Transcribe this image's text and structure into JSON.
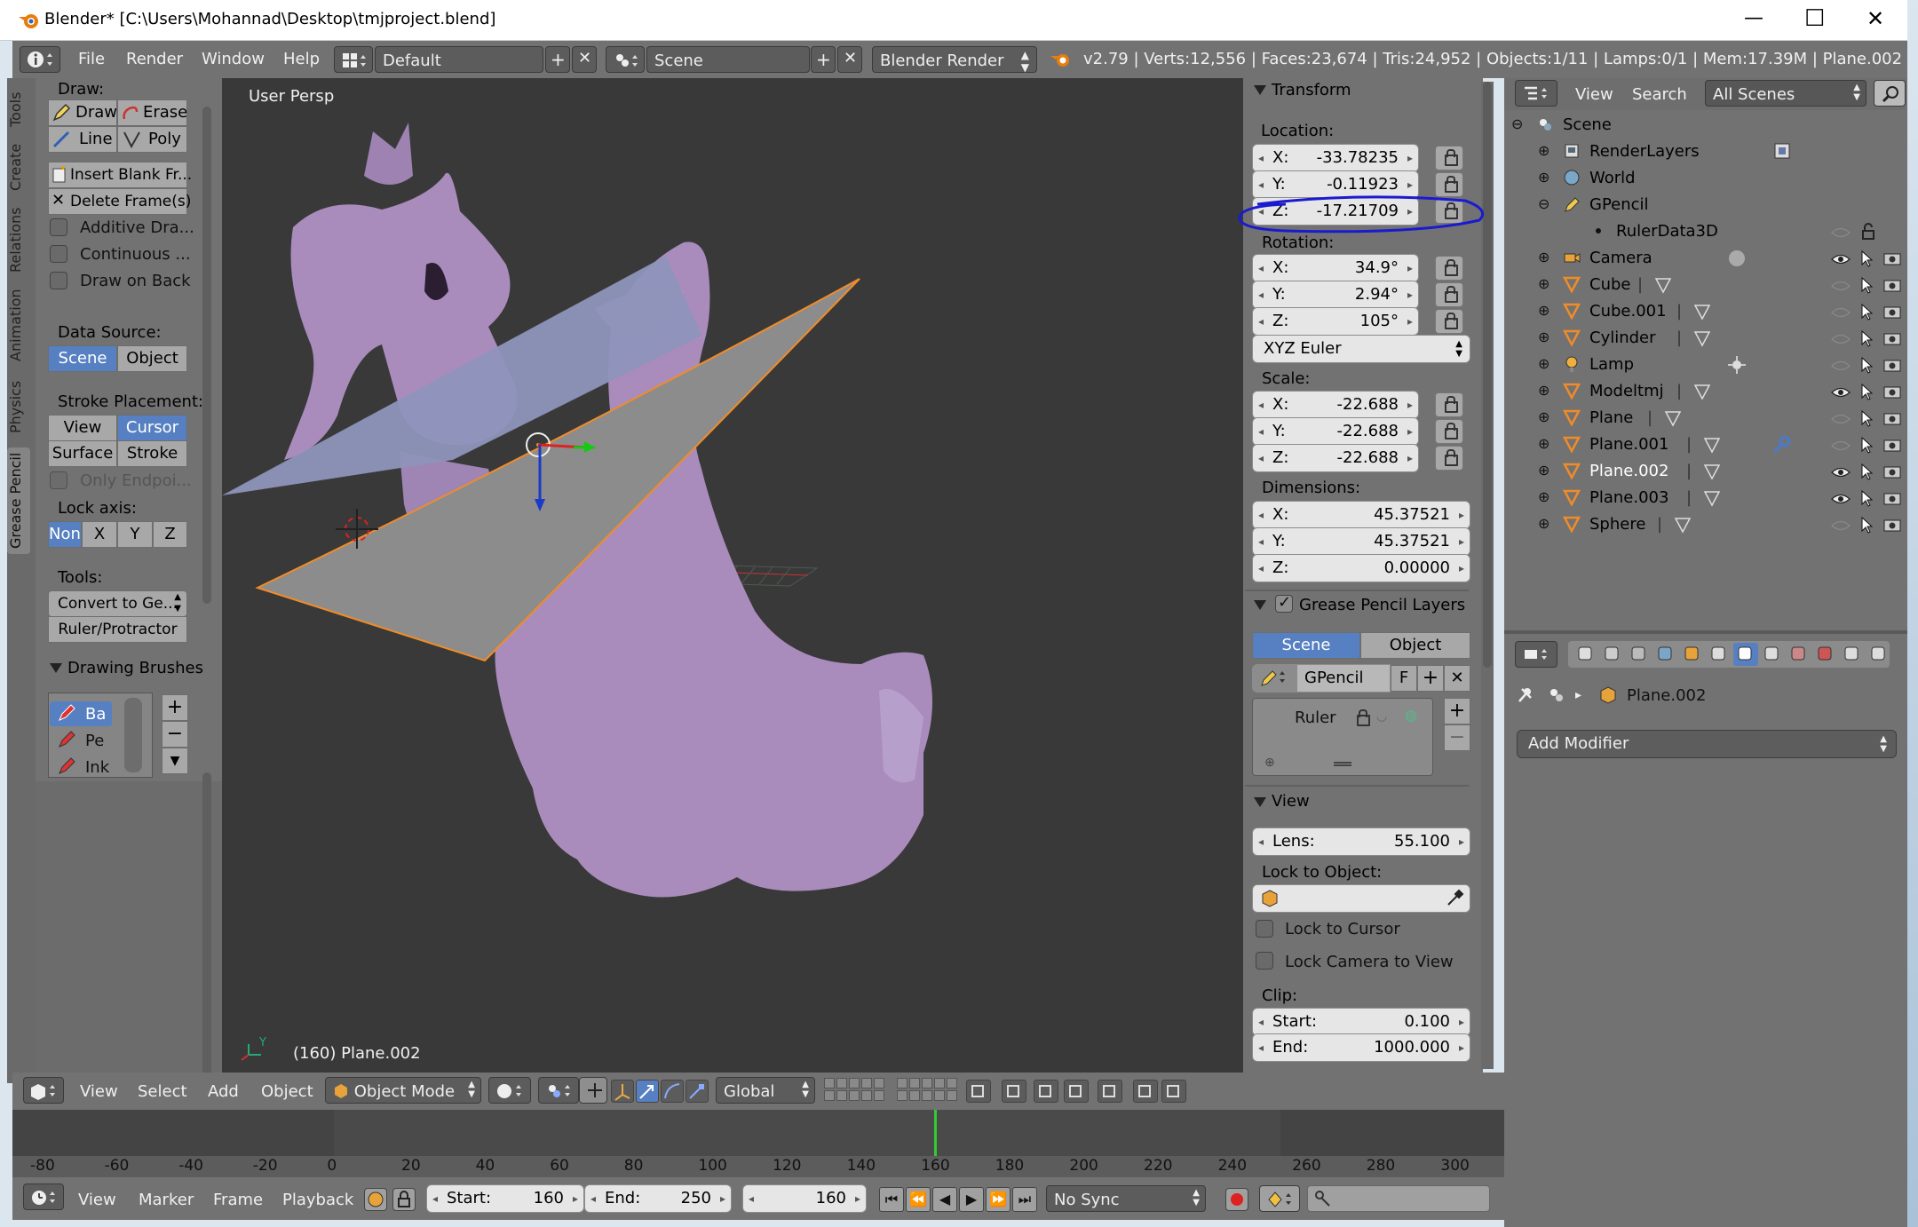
{
  "window": {
    "title": "Blender* [C:\\Users\\Mohannad\\Desktop\\tmjproject.blend]",
    "minimize": "—",
    "maximize": "☐",
    "close": "✕"
  },
  "info_header": {
    "menus": [
      "File",
      "Render",
      "Window",
      "Help"
    ],
    "screen_layout": "Default",
    "scene": "Scene",
    "engine": "Blender Render",
    "stats": "v2.79 | Verts:12,556 | Faces:23,674 | Tris:24,952 | Objects:1/11 | Lamps:0/1 | Mem:17.39M | Plane.002"
  },
  "tool_tabs": [
    "Tools",
    "Create",
    "Relations",
    "Animation",
    "Physics",
    "Grease Pencil"
  ],
  "tool_shelf": {
    "draw_label": "Draw:",
    "draw": "Draw",
    "erase": "Erase",
    "line": "Line",
    "poly": "Poly",
    "insert_blank": "Insert Blank Fr...",
    "delete_frames": "Delete Frame(s)",
    "additive": "Additive Dra...",
    "continuous": "Continuous ...",
    "draw_on_back": "Draw on Back",
    "data_source_label": "Data Source:",
    "ds_scene": "Scene",
    "ds_object": "Object",
    "stroke_placement_label": "Stroke Placement:",
    "sp_view": "View",
    "sp_cursor": "Cursor",
    "sp_surface": "Surface",
    "sp_stroke": "Stroke",
    "only_endpoints": "Only Endpoi...",
    "lock_axis_label": "Lock axis:",
    "lock_axis": [
      "Non",
      "X",
      "Y",
      "Z"
    ],
    "tools_label": "Tools:",
    "convert": "Convert to Ge...",
    "ruler": "Ruler/Protractor",
    "brushes_panel": "Drawing Brushes",
    "brushes": [
      "Ba",
      "Pe",
      "Ink"
    ]
  },
  "viewport": {
    "view_name": "User Persp",
    "object_info": "(160) Plane.002"
  },
  "transform": {
    "title": "Transform",
    "location_label": "Location:",
    "location": [
      {
        "axis": "X:",
        "value": "-33.78235"
      },
      {
        "axis": "Y:",
        "value": "-0.11923"
      },
      {
        "axis": "Z:",
        "value": "-17.21709"
      }
    ],
    "rotation_label": "Rotation:",
    "rotation": [
      {
        "axis": "X:",
        "value": "34.9°"
      },
      {
        "axis": "Y:",
        "value": "2.94°"
      },
      {
        "axis": "Z:",
        "value": "105°"
      }
    ],
    "rotation_mode": "XYZ Euler",
    "scale_label": "Scale:",
    "scale": [
      {
        "axis": "X:",
        "value": "-22.688"
      },
      {
        "axis": "Y:",
        "value": "-22.688"
      },
      {
        "axis": "Z:",
        "value": "-22.688"
      }
    ],
    "dimensions_label": "Dimensions:",
    "dimensions": [
      {
        "axis": "X:",
        "value": "45.37521"
      },
      {
        "axis": "Y:",
        "value": "45.37521"
      },
      {
        "axis": "Z:",
        "value": "0.00000"
      }
    ]
  },
  "gp_layers": {
    "title": "Grease Pencil Layers",
    "scene": "Scene",
    "object": "Object",
    "datablock": "GPencil",
    "fake_user": "F",
    "layer": "Ruler"
  },
  "view_panel": {
    "title": "View",
    "lens_label": "Lens:",
    "lens": "55.100",
    "lock_to_object": "Lock to Object:",
    "lock_to_cursor": "Lock to Cursor",
    "lock_camera": "Lock Camera to View",
    "clip_label": "Clip:",
    "clip_start_label": "Start:",
    "clip_start": "0.100",
    "clip_end_label": "End:",
    "clip_end": "1000.000"
  },
  "outliner": {
    "view": "View",
    "search": "Search",
    "filter": "All Scenes",
    "items": [
      {
        "label": "Scene",
        "indent": 0,
        "icon": "scene"
      },
      {
        "label": "RenderLayers",
        "indent": 1,
        "icon": "renderlayers"
      },
      {
        "label": "World",
        "indent": 1,
        "icon": "world"
      },
      {
        "label": "GPencil",
        "indent": 1,
        "icon": "gpencil"
      },
      {
        "label": "RulerData3D",
        "indent": 2,
        "icon": "dot"
      },
      {
        "label": "Camera",
        "indent": 1,
        "icon": "camera"
      },
      {
        "label": "Cube",
        "indent": 1,
        "icon": "mesh"
      },
      {
        "label": "Cube.001",
        "indent": 1,
        "icon": "mesh"
      },
      {
        "label": "Cylinder",
        "indent": 1,
        "icon": "mesh"
      },
      {
        "label": "Lamp",
        "indent": 1,
        "icon": "lamp"
      },
      {
        "label": "Modeltmj",
        "indent": 1,
        "icon": "mesh"
      },
      {
        "label": "Plane",
        "indent": 1,
        "icon": "mesh"
      },
      {
        "label": "Plane.001",
        "indent": 1,
        "icon": "mesh"
      },
      {
        "label": "Plane.002",
        "indent": 1,
        "icon": "mesh"
      },
      {
        "label": "Plane.003",
        "indent": 1,
        "icon": "mesh"
      },
      {
        "label": "Sphere",
        "indent": 1,
        "icon": "mesh"
      }
    ]
  },
  "properties": {
    "object": "Plane.002",
    "add_modifier": "Add Modifier"
  },
  "view3d_header": {
    "menus": [
      "View",
      "Select",
      "Add",
      "Object"
    ],
    "mode": "Object Mode",
    "orientation": "Global"
  },
  "timeline": {
    "ruler": [
      "-80",
      "-60",
      "-40",
      "-20",
      "0",
      "20",
      "40",
      "60",
      "80",
      "100",
      "120",
      "140",
      "160",
      "180",
      "200",
      "220",
      "240",
      "260",
      "280",
      "300"
    ],
    "menus": [
      "View",
      "Marker",
      "Frame",
      "Playback"
    ],
    "start_label": "Start:",
    "start": "160",
    "end_label": "End:",
    "end": "250",
    "current": "160",
    "sync": "No Sync"
  },
  "colors": {
    "viewport_bg": "#393939",
    "panel_bg": "#727272",
    "accent": "#5680c2",
    "annotation": "#1a1ad0",
    "mesh": "#a98cbc"
  }
}
